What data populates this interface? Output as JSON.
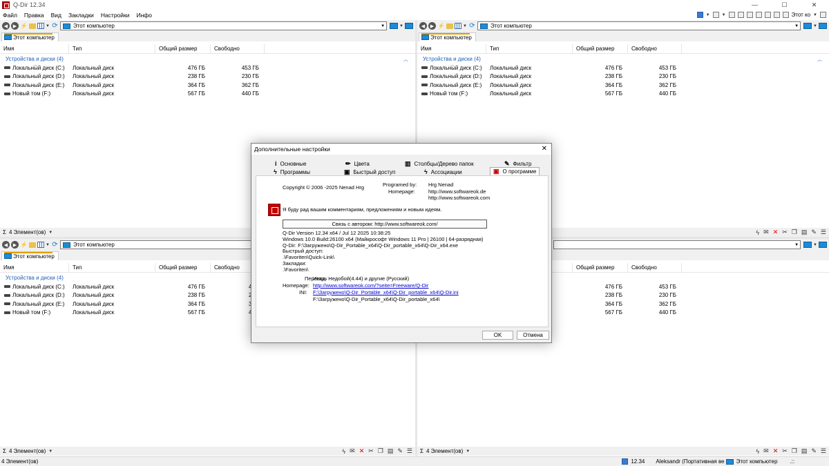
{
  "window": {
    "title": "Q-Dir 12.34",
    "min": "—",
    "max": "☐",
    "close": "✕"
  },
  "menu": [
    "Файл",
    "Правка",
    "Вид",
    "Закладки",
    "Настройки",
    "Инфо"
  ],
  "top_tools": {
    "label": "Этот ко"
  },
  "address": "Этот компьютер",
  "tab_label": "Этот компьютер",
  "columns": [
    "Имя",
    "Тип",
    "Общий размер",
    "Свободно"
  ],
  "group": "Устройства и диски (4)",
  "drives": [
    {
      "name": "Локальный диск (C:)",
      "type": "Локальный диск",
      "total": "476 ГБ",
      "free": "453 ГБ"
    },
    {
      "name": "Локальный диск (D:)",
      "type": "Локальный диск",
      "total": "238 ГБ",
      "free": "230 ГБ"
    },
    {
      "name": "Локальный диск (E:)",
      "type": "Локальный диск",
      "total": "364 ГБ",
      "free": "362 ГБ"
    },
    {
      "name": "Новый том (F:)",
      "type": "Локальный диск",
      "total": "567 ГБ",
      "free": "440 ГБ"
    }
  ],
  "bottom_left_free": [
    "4",
    "2",
    "3",
    "4"
  ],
  "pane_status": "4 Элемент(ов)",
  "bottom_status": {
    "left": "4 Элемент(ов)",
    "version": "12.34",
    "user": "Aleksandr (Портативная ве",
    "location": "Этот компьютер",
    "dots": ".::"
  },
  "dialog": {
    "title": "Дополнительные настройки",
    "tabs_row1": [
      "Основные",
      "Цвета",
      "Столбцы/Дерево папок",
      "Фильтр"
    ],
    "tabs_row2": [
      "Программы",
      "Быстрый доступ",
      "Ассоциации",
      "О программе"
    ],
    "copyright": "Copyright © 2006 -2025 Nenad Hrg",
    "programed_label": "Programed by:",
    "programed_value": "Hrg Nenad",
    "homepage_label": "Homepage:",
    "homepage1": "http://www.softwareok.de",
    "homepage2": "http://www.softwareok.com",
    "feedback": "Я буду рад вашим комментариям, предложениям и новым идеям.",
    "contact_btn": "Связь с автором: http://www.softwareok.com/",
    "info_lines": [
      "Q-Dir Version 12.34  x64  /  Jul 12 2025 10:38:25",
      "Windows 10.0 Build:26100 x64 (Майкрософт Windows 11 Pro | 26100 | 64-разрядная)",
      "Q-Dir: F:\\Загружено\\Q-Dir_Portable_x64\\Q-Dir_portable_x64\\Q-Dir_x64.exe",
      "Быстрый доступ:",
      ".\\Favoriten\\Quick-Link\\",
      "Закладки:",
      ".\\Favoriten\\"
    ],
    "translation_label": "Перевод:",
    "translation_value": "Игорь Недобой(4.44) и другие  (Русский)",
    "homepage2_label": "Homepage:",
    "homepage2_link": "http://www.softwareok.com/?seite=Freeware/Q-Dir",
    "ini_label": "INI:",
    "ini_link": "F:\\Загружено\\Q-Dir_Portable_x64\\Q-Dir_portable_x64\\Q-Dir.ini",
    "ini_dir": "F:\\Загружено\\Q-Dir_Portable_x64\\Q-Dir_portable_x64\\",
    "ok": "OK",
    "cancel": "Отмена"
  }
}
